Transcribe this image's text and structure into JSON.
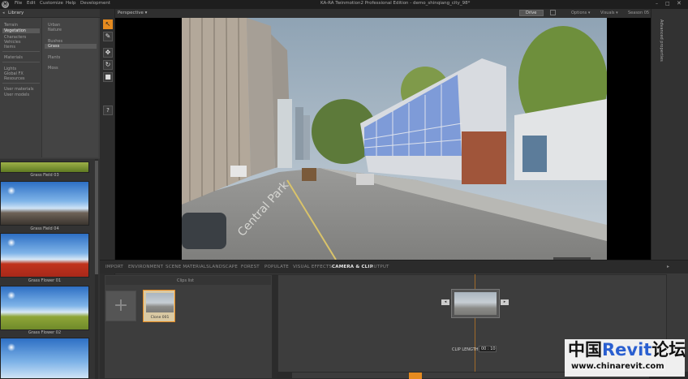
{
  "app": {
    "window_title": "KA-RA Twinmotion2 Professional Edition - demo_shinqiang_city_98*",
    "menu": [
      "File",
      "Edit",
      "Customize",
      "Help",
      "Development"
    ]
  },
  "library": {
    "title": "Library",
    "categories_col1": [
      "Terrain",
      "Vegetation",
      "Characters",
      "Vehicles",
      "Items",
      "Materials",
      "Lights",
      "Global FX",
      "Resources",
      "User materials",
      "User models"
    ],
    "selected_col1": "Vegetation",
    "categories_col2": [
      "Urban",
      "Nature",
      "Bushes",
      "Grass",
      "Plants",
      "Moss"
    ],
    "selected_col2": "Grass",
    "thumbnails": [
      {
        "label": "Grass Field 03"
      },
      {
        "label": "Grass Field 04"
      },
      {
        "label": "Grass Flower 01"
      },
      {
        "label": "Grass Flower 02"
      }
    ]
  },
  "toolbox": {
    "tools": [
      "select-icon",
      "brush-icon",
      "move-icon",
      "rotate-icon",
      "scale-icon",
      "help-icon"
    ],
    "help_label": "?"
  },
  "viewport": {
    "view_label": "Perspective ▾",
    "mode_button": "Drive",
    "menus": [
      "Options ▾",
      "Visuals ▾",
      "Season 05 ▾"
    ],
    "side_label": "Advanced properties",
    "street_sign": "Central Park"
  },
  "tabs": [
    "IMPORT",
    "ENVIRONMENT",
    "SCENE MATERIALS",
    "LANDSCAPE",
    "FOREST",
    "POPULATE",
    "VISUAL EFFECTS",
    "CAMERA & CLIP",
    "OUTPUT"
  ],
  "active_tab": "CAMERA & CLIP",
  "clips": {
    "header": "Clips list",
    "add_label": "+",
    "items": [
      {
        "label": "Clone 001"
      }
    ]
  },
  "timeline": {
    "clip_length_label": "CLIP LENGTH",
    "clip_length_value": "00 : 10"
  },
  "watermark": {
    "title_part1": "中国",
    "title_part2": "Revit",
    "title_part3": "论坛",
    "url": "www.chinarevit.com"
  },
  "colors": {
    "accent": "#e58a1f",
    "watermark_blue": "#2a5fd0"
  }
}
